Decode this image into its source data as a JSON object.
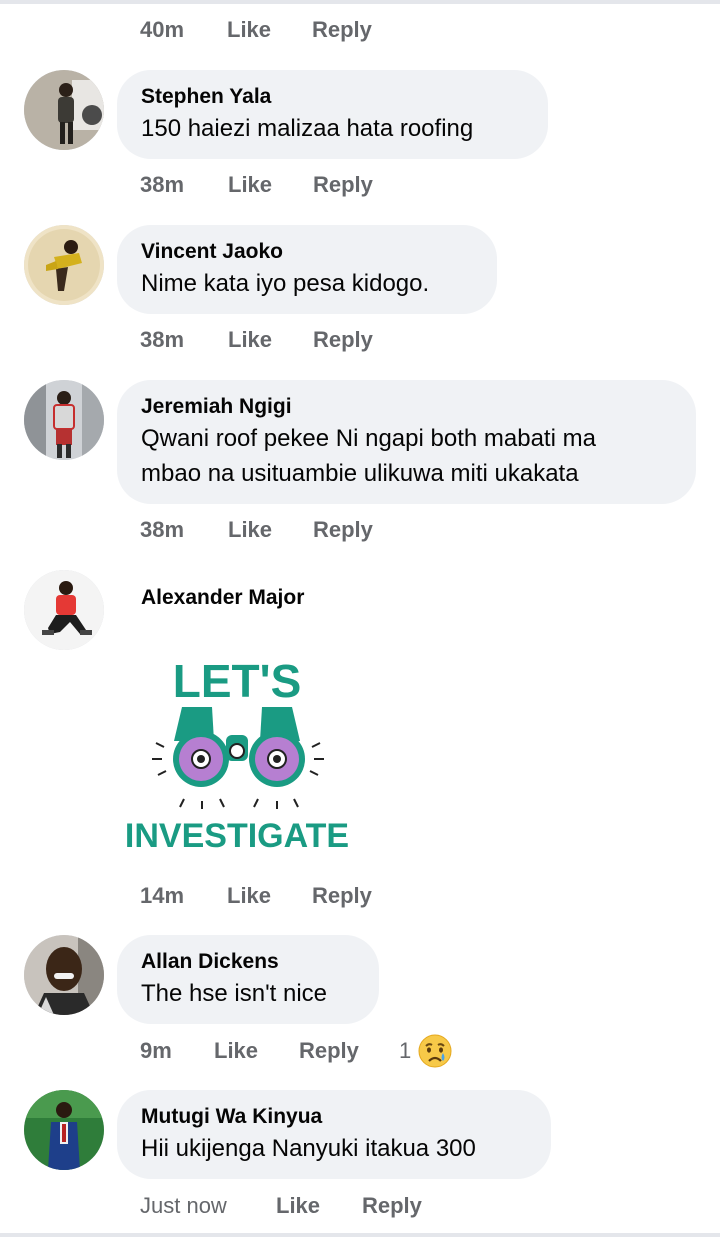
{
  "colors": {
    "bubble": "#f0f2f5",
    "meta_text": "#65676b",
    "sticker_teal": "#1a9b83",
    "sticker_purple": "#b67fd1"
  },
  "comments": [
    {
      "time": "40m",
      "like": "Like",
      "reply": "Reply"
    },
    {
      "name": "Stephen Yala",
      "text": "150 haiezi malizaa hata roofing",
      "time": "38m",
      "like": "Like",
      "reply": "Reply"
    },
    {
      "name": "Vincent Jaoko",
      "text": "Nime kata iyo pesa kidogo.",
      "time": "38m",
      "like": "Like",
      "reply": "Reply"
    },
    {
      "name": "Jeremiah Ngigi",
      "text_lines": [
        "Qwani roof pekee Ni ngapi both mabati ma",
        "mbao na usituambie ulikuwa miti ukakata"
      ],
      "time": "38m",
      "like": "Like",
      "reply": "Reply"
    },
    {
      "name": "Alexander Major",
      "sticker": "lets-investigate-sticker",
      "time": "14m",
      "like": "Like",
      "reply": "Reply"
    },
    {
      "name": "Allan Dickens",
      "text": "The hse isn't nice",
      "time": "9m",
      "like": "Like",
      "reply": "Reply",
      "reaction_count": "1",
      "reaction_icon": "crying-face-icon"
    },
    {
      "name": "Mutugi Wa Kinyua",
      "text": "Hii ukijenga Nanyuki itakua 300",
      "time": "Just now",
      "like": "Like",
      "reply": "Reply"
    }
  ],
  "sticker_text": {
    "top": "LET'S",
    "bottom": "INVESTIGATE"
  }
}
